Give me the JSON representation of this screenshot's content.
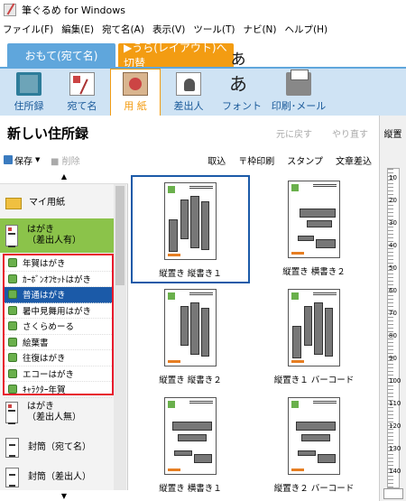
{
  "window": {
    "title": "筆ぐるめ for Windows"
  },
  "menu": [
    "ファイル(F)",
    "編集(E)",
    "宛て名(A)",
    "表示(V)",
    "ツール(T)",
    "ナビ(N)",
    "ヘルプ(H)"
  ],
  "mode_tabs": {
    "front": "おもて(宛て名)",
    "back": "▶うら(レイアウト)へ切替"
  },
  "ribbon": [
    "住所録",
    "宛て名",
    "用 紙",
    "差出人",
    "フォント",
    "印刷･メール"
  ],
  "left_title": "新しい住所録",
  "header_actions": {
    "undo": "元に戻す",
    "redo": "やり直す"
  },
  "side_header": "縦置",
  "toolbar": {
    "save": "保存",
    "delete": "削除",
    "right": [
      "取込",
      "〒枠印刷",
      "スタンプ",
      "文章差込"
    ]
  },
  "categories": {
    "my_paper": "マイ用紙",
    "hagaki_with": [
      "はがき",
      "（差出人有）"
    ],
    "hagaki_without": [
      "はがき",
      "（差出人無）"
    ],
    "envelope_addr": "封筒（宛て名）",
    "envelope_sender": "封筒（差出人）"
  },
  "sub_items": [
    "年賀はがき",
    "ｶｰﾎﾞﾝｵﾌｾｯﾄはがき",
    "普通はがき",
    "暑中見舞用はがき",
    "さくらめーる",
    "絵葉書",
    "往復はがき",
    "エコーはがき",
    "ｷｬﾗｸﾀｰ年賀"
  ],
  "layouts": [
    "縦置き 縦書き１",
    "縦置き 横書き２",
    "縦置き 縦書き２",
    "縦置き１ バーコード",
    "縦置き 横書き１",
    "縦置き２ バーコード"
  ],
  "ruler_numbers": [
    "10",
    "20",
    "30",
    "40",
    "50",
    "60",
    "70",
    "80",
    "90",
    "100",
    "110",
    "120",
    "130",
    "140"
  ],
  "colors": {
    "accent_blue": "#5fa6dc",
    "accent_orange": "#f39c12",
    "selection": "#1b5aa8",
    "highlight_border": "#e81b2d",
    "category_green": "#8bc34a"
  }
}
